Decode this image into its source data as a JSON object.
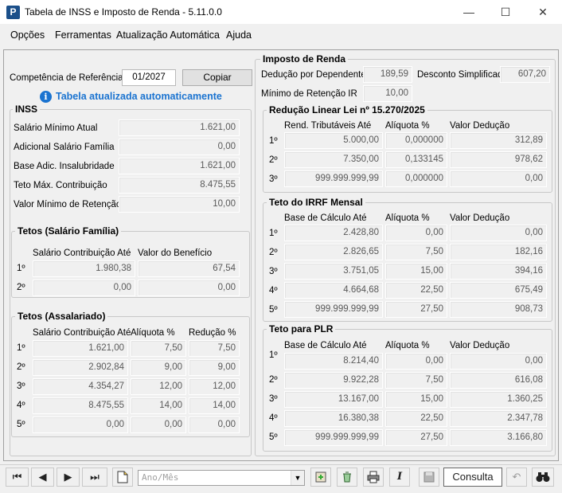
{
  "window": {
    "title": "Tabela de INSS e Imposto de Renda - 5.11.0.0",
    "app_icon_letter": "P",
    "minimize": "—",
    "maximize": "☐",
    "close": "✕"
  },
  "menu": [
    {
      "label": "Opções"
    },
    {
      "label": "Ferramentas"
    },
    {
      "label": "Atualização Automática"
    },
    {
      "label": "Ajuda"
    }
  ],
  "competencia": {
    "label": "Competência de Referência",
    "value": "01/2027",
    "copy_button": "Copiar"
  },
  "info": {
    "icon": "i",
    "text": "Tabela atualizada automaticamente"
  },
  "inss": {
    "title": "INSS",
    "rows": [
      {
        "label": "Salário Mínimo Atual",
        "value": "1.621,00"
      },
      {
        "label": "Adicional Salário Família",
        "value": "0,00"
      },
      {
        "label": "Base Adic. Insalubridade",
        "value": "1.621,00"
      },
      {
        "label": "Teto Máx. Contribuição",
        "value": "8.475,55"
      },
      {
        "label": "Valor Mínimo de Retenção",
        "value": "10,00"
      }
    ]
  },
  "tetos_familia": {
    "title": "Tetos (Salário Família)",
    "headers": [
      "Salário Contribuição Até",
      "Valor do Benefício"
    ],
    "rows": [
      {
        "ord": "1º",
        "a": "1.980,38",
        "b": "67,54"
      },
      {
        "ord": "2º",
        "a": "0,00",
        "b": "0,00"
      }
    ]
  },
  "tetos_assalariado": {
    "title": "Tetos (Assalariado)",
    "headers": [
      "Salário Contribuição Até",
      "Alíquota %",
      "Redução %"
    ],
    "rows": [
      {
        "ord": "1º",
        "a": "1.621,00",
        "b": "7,50",
        "c": "7,50"
      },
      {
        "ord": "2º",
        "a": "2.902,84",
        "b": "9,00",
        "c": "9,00"
      },
      {
        "ord": "3º",
        "a": "4.354,27",
        "b": "12,00",
        "c": "12,00"
      },
      {
        "ord": "4º",
        "a": "8.475,55",
        "b": "14,00",
        "c": "14,00"
      },
      {
        "ord": "5º",
        "a": "0,00",
        "b": "0,00",
        "c": "0,00"
      }
    ]
  },
  "ir": {
    "title": "Imposto de Renda",
    "deducao_label": "Dedução por Dependente",
    "deducao_value": "189,59",
    "desconto_label": "Desconto Simplificado",
    "desconto_value": "607,20",
    "minimo_label": "Mínimo de Retenção IR",
    "minimo_value": "10,00"
  },
  "reducao": {
    "title": "Redução Linear Lei nº 15.270/2025",
    "headers": [
      "Rend. Tributáveis Até",
      "Alíquota %",
      "Valor Dedução"
    ],
    "rows": [
      {
        "ord": "1º",
        "a": "5.000,00",
        "b": "0,000000",
        "c": "312,89"
      },
      {
        "ord": "2º",
        "a": "7.350,00",
        "b": "0,133145",
        "c": "978,62"
      },
      {
        "ord": "3º",
        "a": "999.999.999,99",
        "b": "0,000000",
        "c": "0,00"
      }
    ]
  },
  "irrf": {
    "title": "Teto do IRRF Mensal",
    "headers": [
      "Base de Cálculo Até",
      "Alíquota %",
      "Valor Dedução"
    ],
    "rows": [
      {
        "ord": "1º",
        "a": "2.428,80",
        "b": "0,00",
        "c": "0,00"
      },
      {
        "ord": "2º",
        "a": "2.826,65",
        "b": "7,50",
        "c": "182,16"
      },
      {
        "ord": "3º",
        "a": "3.751,05",
        "b": "15,00",
        "c": "394,16"
      },
      {
        "ord": "4º",
        "a": "4.664,68",
        "b": "22,50",
        "c": "675,49"
      },
      {
        "ord": "5º",
        "a": "999.999.999,99",
        "b": "27,50",
        "c": "908,73"
      }
    ]
  },
  "plr": {
    "title": "Teto para PLR",
    "headers": [
      "Base de Cálculo Até",
      "Alíquota %",
      "Valor Dedução"
    ],
    "rows": [
      {
        "ord": "1º",
        "a": "8.214,40",
        "b": "0,00",
        "c": "0,00"
      },
      {
        "ord": "2º",
        "a": "9.922,28",
        "b": "7,50",
        "c": "616,08"
      },
      {
        "ord": "3º",
        "a": "13.167,00",
        "b": "15,00",
        "c": "1.360,25"
      },
      {
        "ord": "4º",
        "a": "16.380,38",
        "b": "22,50",
        "c": "2.347,78"
      },
      {
        "ord": "5º",
        "a": "999.999.999,99",
        "b": "27,50",
        "c": "3.166,80"
      }
    ]
  },
  "toolbar": {
    "first": "⏮",
    "prev": "◀",
    "next": "▶",
    "last": "⏭",
    "combo_placeholder": "Ano/Mês",
    "consulta": "Consulta",
    "icons": [
      "first-icon",
      "prev-icon",
      "next-icon",
      "last-icon",
      "new-doc-icon",
      "export-icon",
      "recycle-icon",
      "print-icon",
      "italic-icon",
      "save-icon",
      "undo-icon",
      "binoculars-icon"
    ]
  }
}
